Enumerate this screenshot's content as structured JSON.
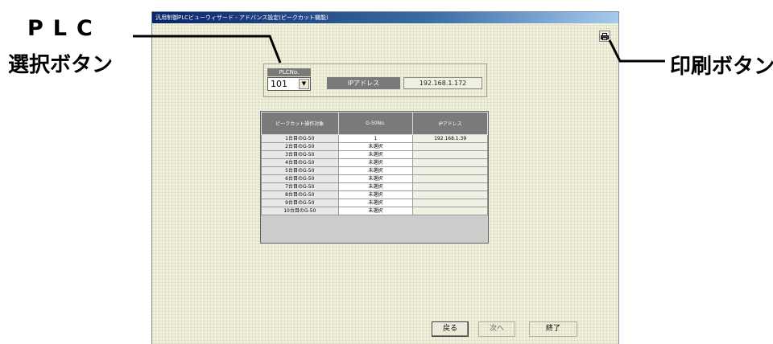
{
  "callouts": {
    "plc_line1": "PLC",
    "plc_line2": "選択ボタン",
    "print": "印刷ボタン"
  },
  "window": {
    "title": "汎用制御PLCビューウィザード - アドバンス設定(ピークカット機能)"
  },
  "plc": {
    "label": "PLCNo.",
    "selected": "101",
    "ip_label": "IPアドレス",
    "ip_value": "192.168.1.172"
  },
  "table": {
    "headers": [
      "ピークカット操作対象",
      "G-50No.",
      "IPアドレス"
    ],
    "rows": [
      [
        "1台目のG-50",
        "1",
        "192.168.1.39"
      ],
      [
        "2台目のG-50",
        "未選択",
        ""
      ],
      [
        "3台目のG-50",
        "未選択",
        ""
      ],
      [
        "4台目のG-50",
        "未選択",
        ""
      ],
      [
        "5台目のG-50",
        "未選択",
        ""
      ],
      [
        "6台目のG-50",
        "未選択",
        ""
      ],
      [
        "7台目のG-50",
        "未選択",
        ""
      ],
      [
        "8台目のG-50",
        "未選択",
        ""
      ],
      [
        "9台目のG-50",
        "未選択",
        ""
      ],
      [
        "10台目のG-50",
        "未選択",
        ""
      ]
    ]
  },
  "buttons": {
    "back": "戻る",
    "next": "次へ",
    "exit": "終了"
  },
  "icons": {
    "print": "printer-icon",
    "dropdown": "chevron-down-icon"
  }
}
